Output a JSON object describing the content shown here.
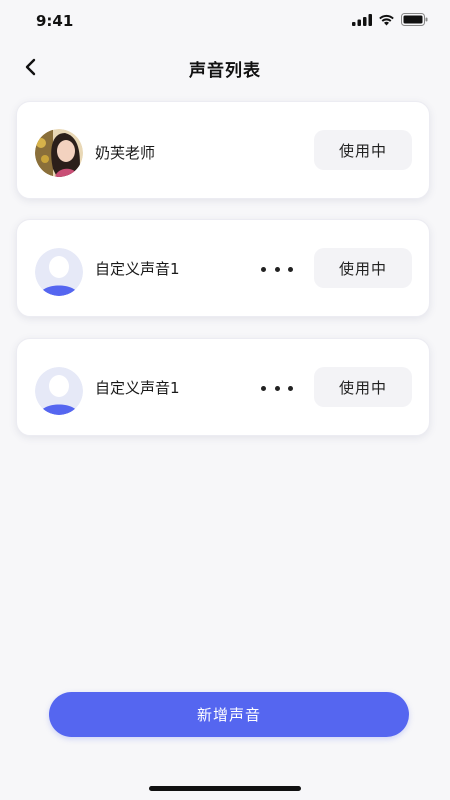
{
  "status_bar": {
    "time": "9:41"
  },
  "header": {
    "title": "声音列表",
    "back_icon": "chevron-left-icon"
  },
  "voices": [
    {
      "name": "奶芙老师",
      "avatar": "photo-avatar",
      "has_more": false,
      "action_label": "使用中"
    },
    {
      "name": "自定义声音1",
      "avatar": "default-user-avatar",
      "has_more": true,
      "action_label": "使用中"
    },
    {
      "name": "自定义声音1",
      "avatar": "default-user-avatar",
      "has_more": true,
      "action_label": "使用中"
    }
  ],
  "footer": {
    "add_label": "新增声音"
  },
  "colors": {
    "accent": "#5566f0",
    "background": "#f7f7f9",
    "card": "#ffffff",
    "button_gray": "#f3f3f6"
  }
}
